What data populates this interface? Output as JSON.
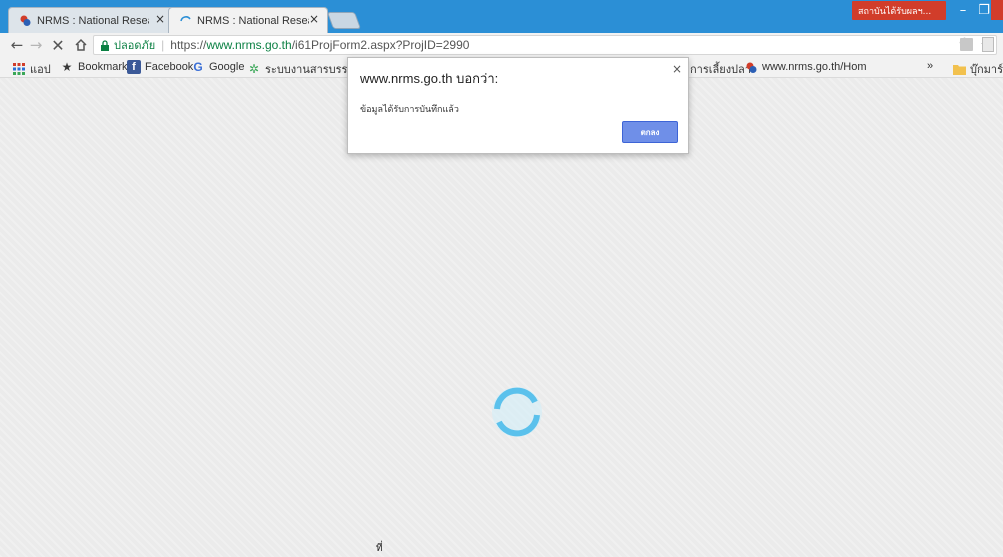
{
  "tabs": [
    {
      "title": "NRMS : National Researc",
      "close": "×"
    },
    {
      "title": "NRMS : National Researc",
      "close": "×"
    }
  ],
  "system": {
    "badge_text": "สถาบันได้รับผลฯ...",
    "minimize": "–",
    "maximize": "❐"
  },
  "toolbar": {
    "secure_label": "ปลอดภัย",
    "url_scheme": "https://",
    "url_host": "www.nrms.go.th",
    "url_path": "/i61ProjForm2.aspx?ProjID=2990"
  },
  "bookmarks": {
    "apps": "แอป",
    "items": [
      {
        "label": "Bookmarks",
        "icon": "star-icon"
      },
      {
        "label": "Facebook",
        "icon": "facebook-icon"
      },
      {
        "label": "Google",
        "icon": "google-icon"
      },
      {
        "label": "ระบบงานสารบรรณ",
        "icon": "thai-site-icon"
      },
      {
        "label": "การเลี้ยงปลา",
        "icon": "thai-site-icon"
      },
      {
        "label": "www.nrms.go.th/Hom",
        "icon": "nrms-icon"
      }
    ],
    "overflow": "»",
    "other_bookmarks": "บุ๊กมาร์ก"
  },
  "dialog": {
    "title": "www.nrms.go.th บอกว่า:",
    "message": "ข้อมูลได้รับการบันทึกแล้ว",
    "ok_label": "ตกลง",
    "close": "×"
  },
  "page": {
    "bottom_text": "ที่"
  },
  "colors": {
    "titlebar": "#2b8fd6",
    "spinner": "#6cc7ef",
    "ok_button": "#6f8fe8"
  }
}
